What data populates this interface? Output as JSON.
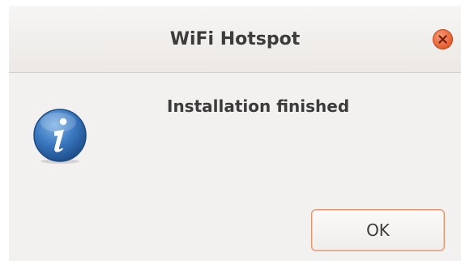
{
  "window": {
    "title": "WiFi Hotspot"
  },
  "dialog": {
    "message": "Installation finished",
    "icon": "info-icon",
    "ok_label": "OK"
  },
  "colors": {
    "close_button": "#e45a2b",
    "info_icon": "#2f6db0",
    "button_border": "#e0956e"
  }
}
